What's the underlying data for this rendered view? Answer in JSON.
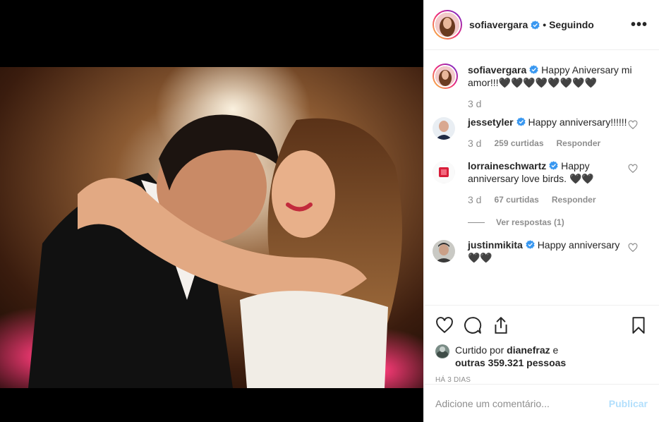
{
  "post": {
    "author": "sofiavergara",
    "follow_status": "• Seguindo",
    "more_icon": "more-dots-icon",
    "caption": "Happy Aniversary mi amor!!!🖤🖤🖤🖤🖤🖤🖤🖤",
    "caption_time": "3 d"
  },
  "comments": [
    {
      "user": "jessetyler",
      "text": "Happy anniversary!!!!!!",
      "time": "3 d",
      "likes": "259 curtidas",
      "reply": "Responder"
    },
    {
      "user": "lorraineschwartz",
      "text": "Happy anniversary love birds. 🖤🖤",
      "time": "3 d",
      "likes": "67 curtidas",
      "reply": "Responder",
      "view_replies": "Ver respostas (1)"
    },
    {
      "user": "justinmikita",
      "text": "Happy anniversary 🖤🖤"
    }
  ],
  "actions": {
    "liked_prefix": "Curtido por",
    "liked_user": "dianefraz",
    "liked_and": "e",
    "liked_others": "outras 359.321 pessoas",
    "date": "HÁ 3 DIAS"
  },
  "composer": {
    "placeholder": "Adicione um comentário...",
    "publish": "Publicar"
  },
  "colors": {
    "verified": "#3897f0",
    "publish_disabled": "#b2dffc",
    "muted": "#8e8e8e"
  }
}
